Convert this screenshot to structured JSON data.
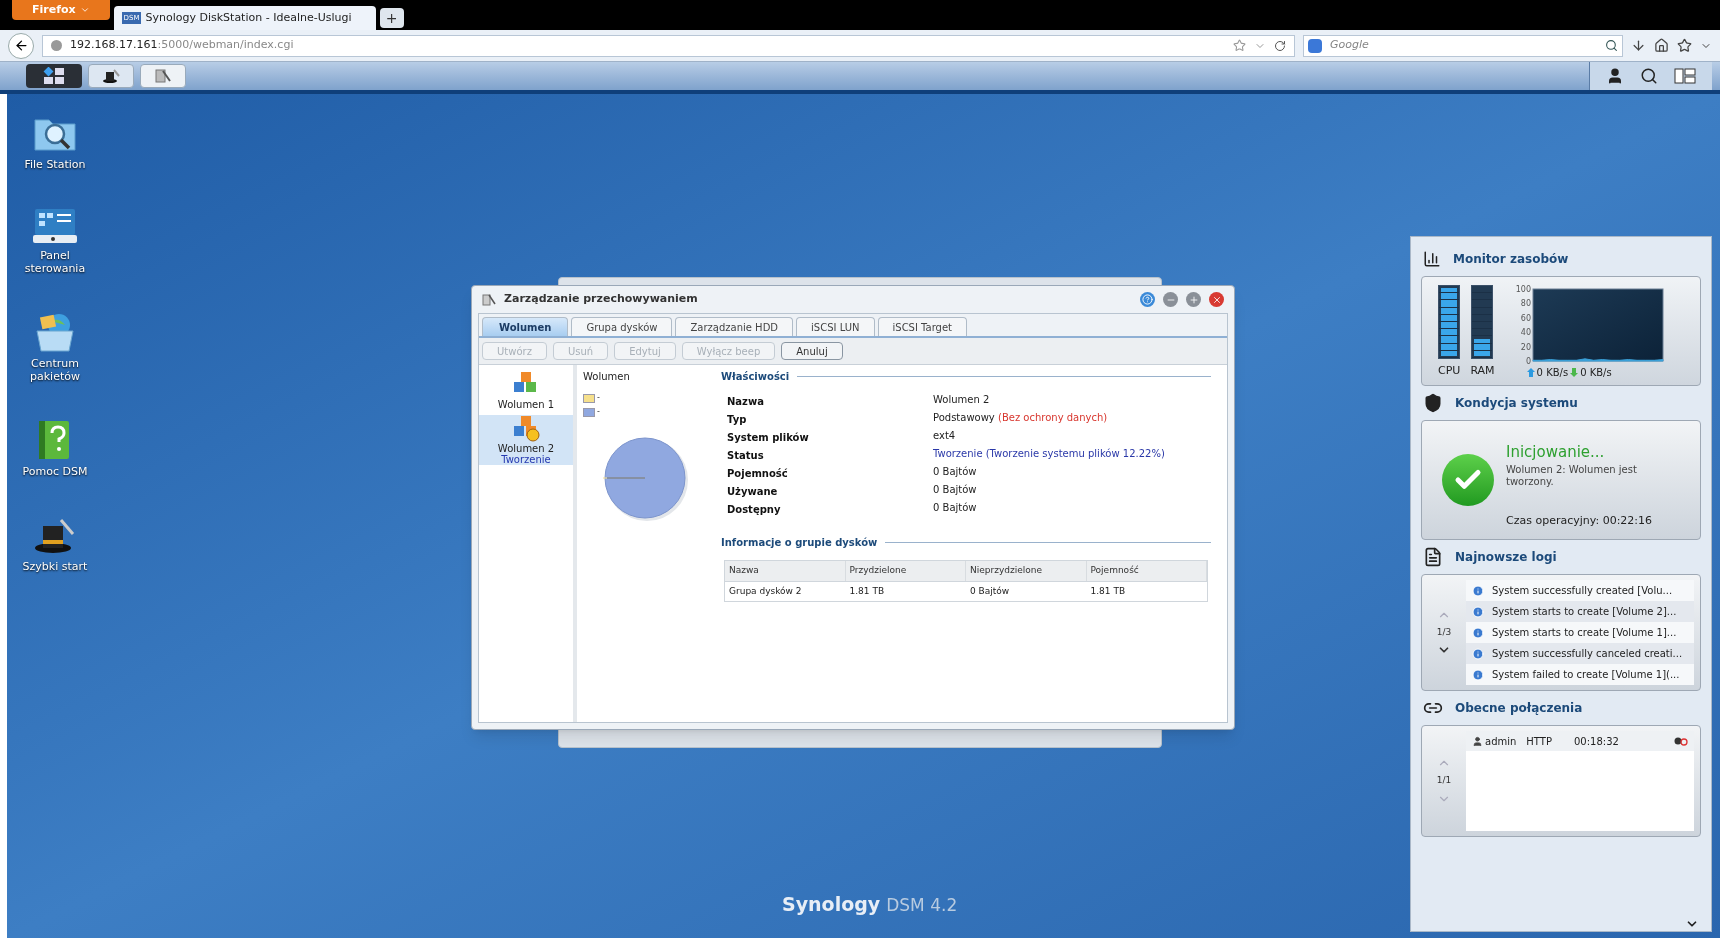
{
  "browser": {
    "menu_button": "Firefox",
    "tabs": [
      {
        "title": "Synology DiskStation - Idealne-Uslugi",
        "favicon": "DSM",
        "selected": true
      }
    ],
    "new_tab": "+",
    "url_host": "192.168.17.161",
    "url_rest": ":5000/webman/index.cgi",
    "search_placeholder": "Google"
  },
  "desktop_icons": [
    {
      "label": "File Station",
      "kind": "files"
    },
    {
      "label": "Panel sterowania",
      "kind": "panel"
    },
    {
      "label": "Centrum pakietów",
      "kind": "package"
    },
    {
      "label": "Pomoc DSM",
      "kind": "help"
    },
    {
      "label": "Szybki start",
      "kind": "hat"
    }
  ],
  "window": {
    "title": "Zarządzanie przechowywaniem",
    "tabs": [
      {
        "label": "Wolumen",
        "selected": true
      },
      {
        "label": "Grupa dysków",
        "selected": false
      },
      {
        "label": "Zarządzanie HDD",
        "selected": false
      },
      {
        "label": "iSCSI LUN",
        "selected": false
      },
      {
        "label": "iSCSI Target",
        "selected": false
      }
    ],
    "toolbar": [
      {
        "label": "Utwórz",
        "disabled": true
      },
      {
        "label": "Usuń",
        "disabled": true
      },
      {
        "label": "Edytuj",
        "disabled": true
      },
      {
        "label": "Wyłącz beep",
        "disabled": true
      },
      {
        "label": "Anuluj",
        "disabled": false
      }
    ],
    "volumes": [
      {
        "name": "Wolumen 1",
        "selected": false
      },
      {
        "name": "Wolumen 2",
        "status": "Tworzenie",
        "selected": true
      }
    ],
    "chart_label": "Wolumen",
    "legend": [
      {
        "label": "-",
        "color": "#f6e08c"
      },
      {
        "label": "-",
        "color": "#90a8e0"
      }
    ],
    "properties_title": "Właściwości",
    "properties": [
      {
        "label": "Nazwa",
        "value": "Wolumen 2",
        "kind": "text"
      },
      {
        "label": "Typ",
        "value": "Podstawowy",
        "note": "(Bez ochrony danych)",
        "kind": "text"
      },
      {
        "label": "System plików",
        "value": "ext4",
        "kind": "text"
      },
      {
        "label": "Status",
        "value": "Tworzenie (Tworzenie systemu plików 12.22%)",
        "kind": "status"
      },
      {
        "label": "Pojemność",
        "value": "0 Bajtów",
        "kind": "text"
      },
      {
        "label": "Używane",
        "value": "0 Bajtów",
        "kind": "text"
      },
      {
        "label": "Dostępny",
        "value": "0 Bajtów",
        "kind": "text"
      }
    ],
    "group_title": "Informacje o grupie dysków",
    "group_table": {
      "columns": [
        "Nazwa",
        "Przydzielone",
        "Nieprzydzielone",
        "Pojemność"
      ],
      "rows": [
        [
          "Grupa dysków 2",
          "1.81 TB",
          "0 Bajtów",
          "1.81 TB"
        ]
      ]
    }
  },
  "widgets": {
    "monitor": {
      "title": "Monitor zasobów",
      "meters": [
        {
          "label": "CPU",
          "level": 1.0
        },
        {
          "label": "RAM",
          "level": 0.25
        }
      ],
      "chart_data": {
        "type": "area",
        "ylim": [
          0,
          100
        ],
        "yticks": [
          0,
          20,
          40,
          60,
          80,
          100
        ],
        "series": [
          {
            "color": "#3aa0d8",
            "values": [
              1,
              1,
              2,
              1,
              1,
              1,
              3,
              1,
              2,
              1,
              1,
              2,
              1,
              1,
              1,
              2
            ]
          }
        ]
      },
      "upload": "0 KB/s",
      "download": "0 KB/s"
    },
    "health": {
      "title": "Kondycja systemu",
      "status": "Inicjowanie...",
      "message": "Wolumen 2: Wolumen jest tworzony.",
      "uptime": "Czas operacyjny: 00:22:16"
    },
    "logs": {
      "title": "Najnowsze logi",
      "page": "1/3",
      "entries": [
        "System successfully created [Volu...",
        "System starts to create [Volume 2]...",
        "System starts to create [Volume 1]...",
        "System successfully canceled creati...",
        "System failed to create [Volume 1](..."
      ]
    },
    "connections": {
      "title": "Obecne połączenia",
      "page": "1/1",
      "entries": [
        {
          "user": "admin",
          "protocol": "HTTP",
          "time": "00:18:32"
        }
      ]
    }
  },
  "brand": {
    "name": "Synology",
    "product": "DSM 4.2"
  }
}
